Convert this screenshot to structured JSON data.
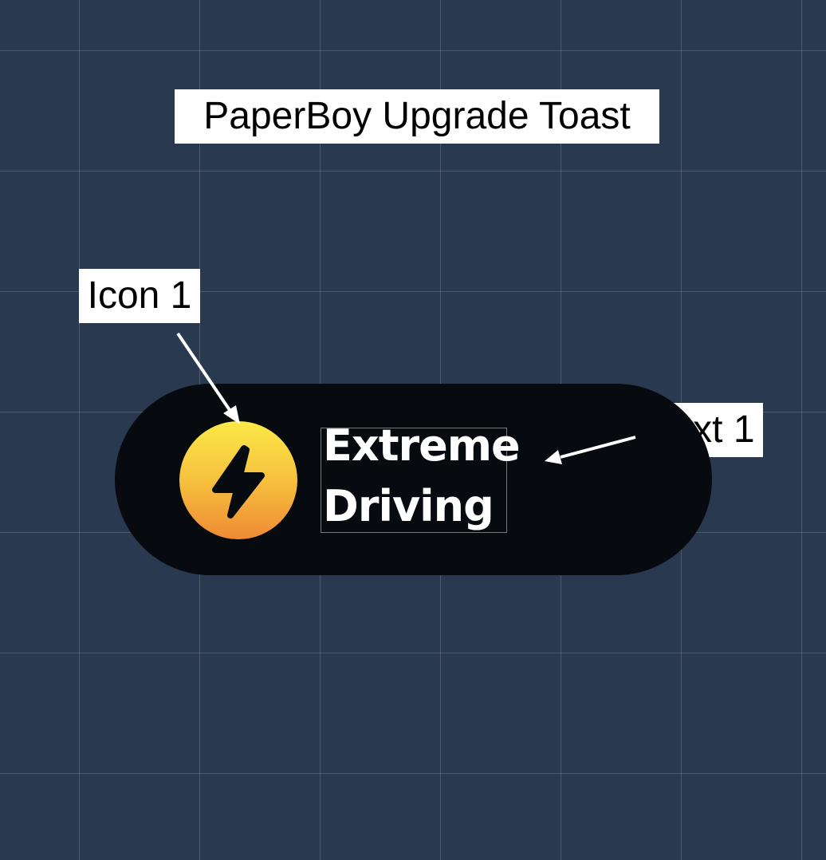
{
  "diagram": {
    "title": "PaperBoy Upgrade Toast",
    "annotations": {
      "icon": "Icon 1",
      "text": "Text 1"
    },
    "toast": {
      "line1": "Extreme",
      "line2": "Driving",
      "icon": "lightning-bolt-icon"
    }
  },
  "colors": {
    "background": "#29394f",
    "toast_background": "#070a0e",
    "icon_gradient_top": "#fbe947",
    "icon_gradient_bottom": "#ef8a35",
    "toast_text": "#ffffff",
    "label_background": "#ffffff"
  }
}
